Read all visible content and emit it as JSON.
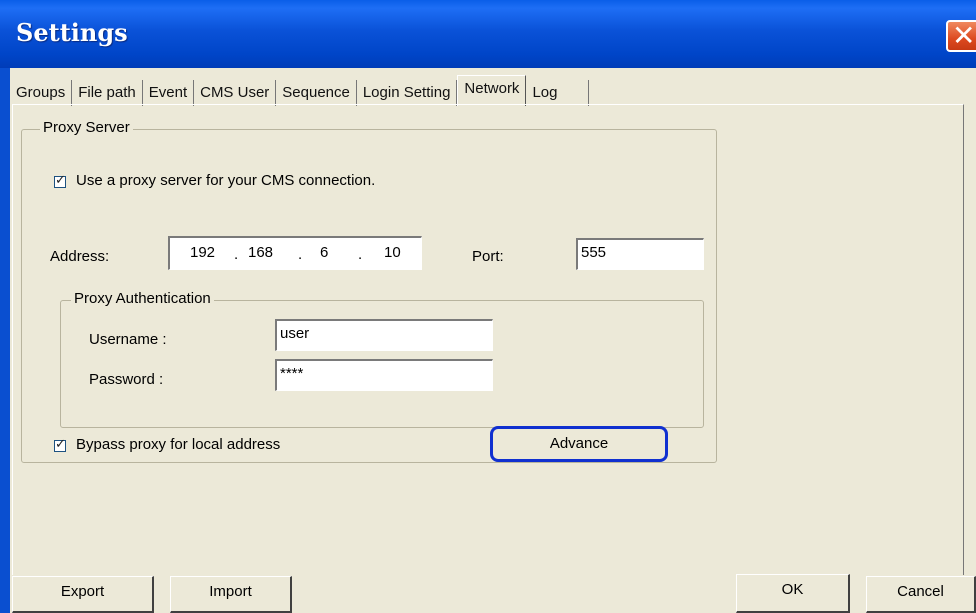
{
  "window": {
    "title": "Settings",
    "close_glyph": "✕"
  },
  "tabs": [
    "Groups",
    "File path",
    "Event",
    "CMS User",
    "Sequence",
    "Login Setting",
    "Network",
    "Log"
  ],
  "active_tab": "Network",
  "proxy": {
    "group_label": "Proxy Server",
    "use_proxy_label": "Use a proxy server for your CMS connection.",
    "use_proxy_checked": true,
    "address_label": "Address:",
    "address": [
      "192",
      "168",
      "6",
      "10"
    ],
    "address_dot": ".",
    "port_label": "Port:",
    "port": "555",
    "auth": {
      "group_label": "Proxy Authentication",
      "username_label": "Username :",
      "username": "user",
      "password_label": "Password :",
      "password": "****"
    },
    "bypass_label": "Bypass proxy for local address",
    "bypass_checked": true,
    "advance_button": "Advance"
  },
  "footer": {
    "export_button": "Export",
    "import_button": "Import",
    "ok_button": "OK",
    "cancel_button": "Cancel"
  },
  "colors": {
    "titlebar": "#0a52d8",
    "close_button": "#dd4a20",
    "dialog_bg": "#ece9d8",
    "advance_highlight": "#1030d0"
  },
  "icons": {
    "close": "close-icon",
    "checkbox_check": "check-icon"
  }
}
